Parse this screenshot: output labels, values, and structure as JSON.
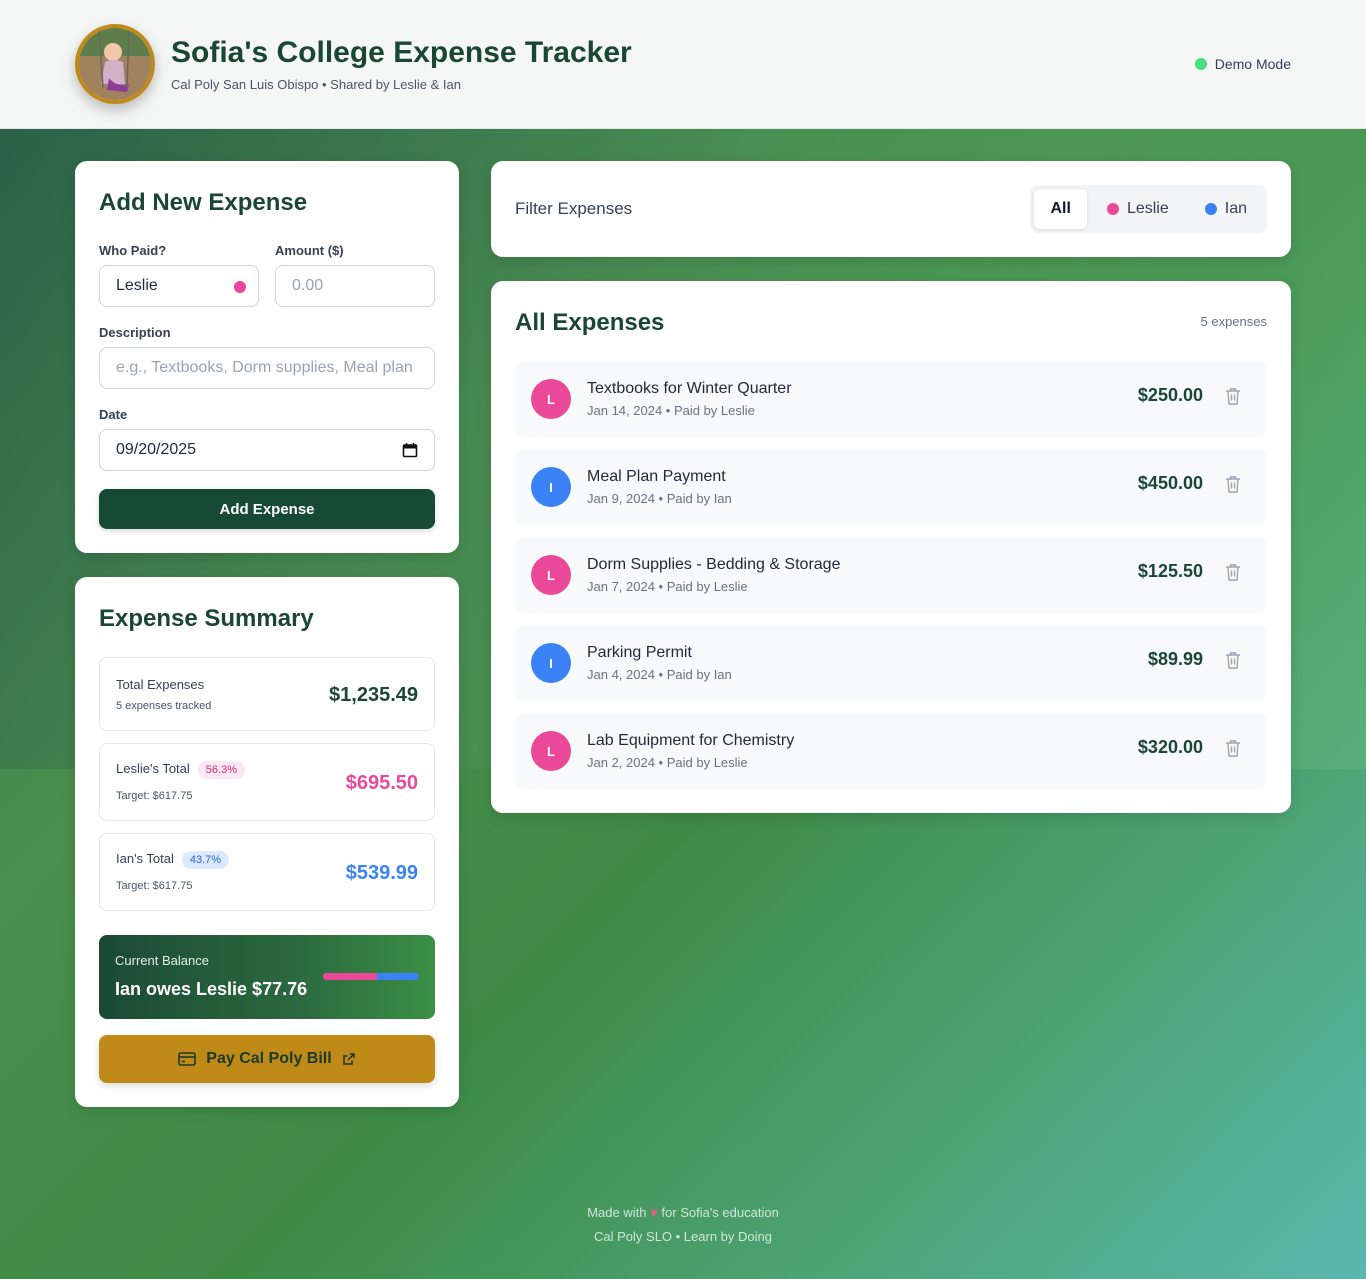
{
  "header": {
    "title": "Sofia's College Expense Tracker",
    "subtitle": "Cal Poly San Luis Obispo • Shared by Leslie & Ian",
    "mode": "Demo Mode",
    "mode_color": "#4ade80"
  },
  "add_form": {
    "heading": "Add New Expense",
    "who_label": "Who Paid?",
    "who_value": "Leslie",
    "amount_label": "Amount ($)",
    "amount_placeholder": "0.00",
    "description_label": "Description",
    "description_placeholder": "e.g., Textbooks, Dorm supplies, Meal plan",
    "date_label": "Date",
    "date_value": "09/20/2025",
    "submit_label": "Add Expense"
  },
  "summary": {
    "heading": "Expense Summary",
    "total_label": "Total Expenses",
    "total_sub": "5 expenses tracked",
    "total_value": "$1,235.49",
    "leslie_label": "Leslie's Total",
    "leslie_pct": "56.3%",
    "leslie_target": "Target: $617.75",
    "leslie_value": "$695.50",
    "ian_label": "Ian's Total",
    "ian_pct": "43.7%",
    "ian_target": "Target: $617.75",
    "ian_value": "$539.99",
    "balance_label": "Current Balance",
    "balance_value": "Ian owes Leslie $77.76",
    "balance_split": 0.563,
    "pay_label": "Pay Cal Poly Bill"
  },
  "filter": {
    "heading": "Filter Expenses",
    "tabs": [
      "All",
      "Leslie",
      "Ian"
    ],
    "active": "All"
  },
  "list": {
    "heading": "All Expenses",
    "count": "5 expenses",
    "items": [
      {
        "initial": "L",
        "title": "Textbooks for Winter Quarter",
        "meta": "Jan 14, 2024 • Paid by Leslie",
        "amount": "$250.00",
        "color": "#ec4899"
      },
      {
        "initial": "I",
        "title": "Meal Plan Payment",
        "meta": "Jan 9, 2024 • Paid by Ian",
        "amount": "$450.00",
        "color": "#3b82f6"
      },
      {
        "initial": "L",
        "title": "Dorm Supplies - Bedding & Storage",
        "meta": "Jan 7, 2024 • Paid by Leslie",
        "amount": "$125.50",
        "color": "#ec4899"
      },
      {
        "initial": "I",
        "title": "Parking Permit",
        "meta": "Jan 4, 2024 • Paid by Ian",
        "amount": "$89.99",
        "color": "#3b82f6"
      },
      {
        "initial": "L",
        "title": "Lab Equipment for Chemistry",
        "meta": "Jan 2, 2024 • Paid by Leslie",
        "amount": "$320.00",
        "color": "#ec4899"
      }
    ]
  },
  "colors": {
    "leslie": "#ec4899",
    "ian": "#3b82f6",
    "brand": "#1a4636",
    "gold": "#bf8a17"
  },
  "footer": {
    "line1_pre": "Made with",
    "line1_post": "for Sofia's education",
    "line2": "Cal Poly SLO • Learn by Doing"
  }
}
